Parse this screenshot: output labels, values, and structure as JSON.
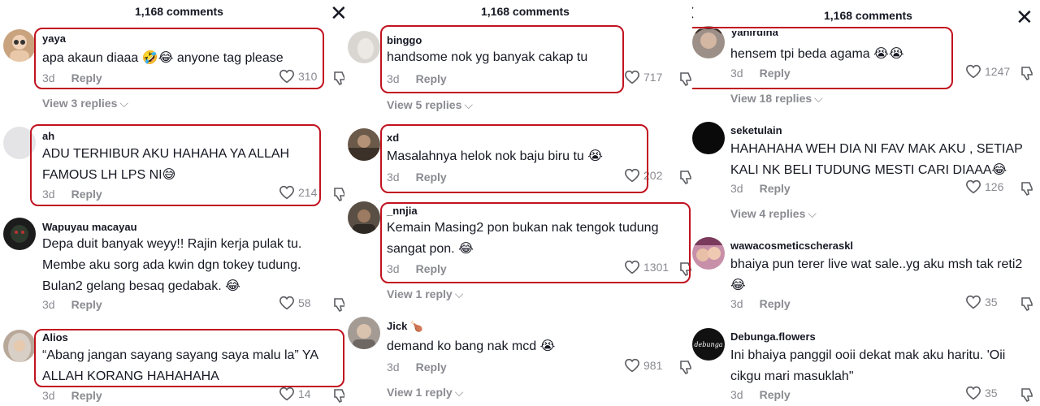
{
  "panels": [
    {
      "header": "1,168 comments",
      "comments": [
        {
          "username": "yaya",
          "text": "apa akaun diaaa 🤣😂 anyone tag please",
          "time": "3d",
          "reply": "Reply",
          "likes": "310",
          "view_replies": "View 3 replies",
          "avatar_color": "#c9a27e"
        },
        {
          "username": "ah",
          "text": "ADU TERHIBUR AKU HAHAHA YA ALLAH FAMOUS LH LPS NI😅",
          "time": "3d",
          "reply": "Reply",
          "likes": "214",
          "view_replies": "",
          "avatar_color": "#e4e4e6"
        },
        {
          "username": "Wapuyau macayau",
          "text": "Depa duit banyak weyy!! Rajin kerja pulak tu. Membe aku sorg ada kwin dgn tokey tudung. Bulan2 gelang besaq gedabak. 😂",
          "time": "3d",
          "reply": "Reply",
          "likes": "58",
          "view_replies": "",
          "avatar_color": "#1c1c1c"
        },
        {
          "username": "Alios",
          "text": "“Abang jangan sayang sayang saya malu la” YA ALLAH KORANG HAHAHAHA",
          "time": "3d",
          "reply": "Reply",
          "likes": "14",
          "view_replies": "",
          "avatar_color": "#b8a89a"
        }
      ]
    },
    {
      "header": "1,168 comments",
      "comments": [
        {
          "username": "binggo",
          "text": "handsome nok yg banyak cakap tu",
          "time": "3d",
          "reply": "Reply",
          "likes": "717",
          "view_replies": "View 5 replies",
          "avatar_color": "#d9d6d2"
        },
        {
          "username": "xd",
          "text": "Masalahnya helok nok baju biru tu 😭",
          "time": "3d",
          "reply": "Reply",
          "likes": "202",
          "view_replies": "",
          "avatar_color": "#6b5a4a"
        },
        {
          "username": "_nnjia",
          "text": "Kemain Masing2 pon bukan nak tengok tudung sangat pon. 😂",
          "time": "3d",
          "reply": "Reply",
          "likes": "1301",
          "view_replies": "View 1 reply",
          "avatar_color": "#5a4f45"
        },
        {
          "username": "Jick 🍗",
          "text": "demand ko bang nak mcd 😭",
          "time": "3d",
          "reply": "Reply",
          "likes": "981",
          "view_replies": "View 1 reply",
          "avatar_color": "#a39b94"
        }
      ]
    },
    {
      "header": "1,168 comments",
      "comments": [
        {
          "username": "yanirdina",
          "text": "hensem tpi beda agama 😭😭",
          "time": "3d",
          "reply": "Reply",
          "likes": "1247",
          "view_replies": "View 18 replies",
          "avatar_color": "#9c8f88"
        },
        {
          "username": "seketulain",
          "text": "HAHAHAHA WEH DIA NI FAV MAK AKU , SETIAP KALI NK BELI TUDUNG MESTI CARI DIAAA😂",
          "time": "3d",
          "reply": "Reply",
          "likes": "126",
          "view_replies": "View 4 replies",
          "avatar_color": "#0a0a0a"
        },
        {
          "username": "wawacosmeticscheraskl",
          "text": "bhaiya pun terer live wat sale..yg aku msh tak reti2 😂",
          "time": "3d",
          "reply": "Reply",
          "likes": "35",
          "view_replies": "",
          "avatar_color": "#c78fa8"
        },
        {
          "username": "Debunga.flowers",
          "text": "Ini bhaiya panggil ooii dekat mak aku haritu. 'Oii cikgu mari masuklah\"",
          "time": "3d",
          "reply": "Reply",
          "likes": "35",
          "view_replies": "",
          "avatar_color": "#111111",
          "avatar_text": "debunga"
        }
      ]
    }
  ],
  "highlight_color": "#c1121f"
}
